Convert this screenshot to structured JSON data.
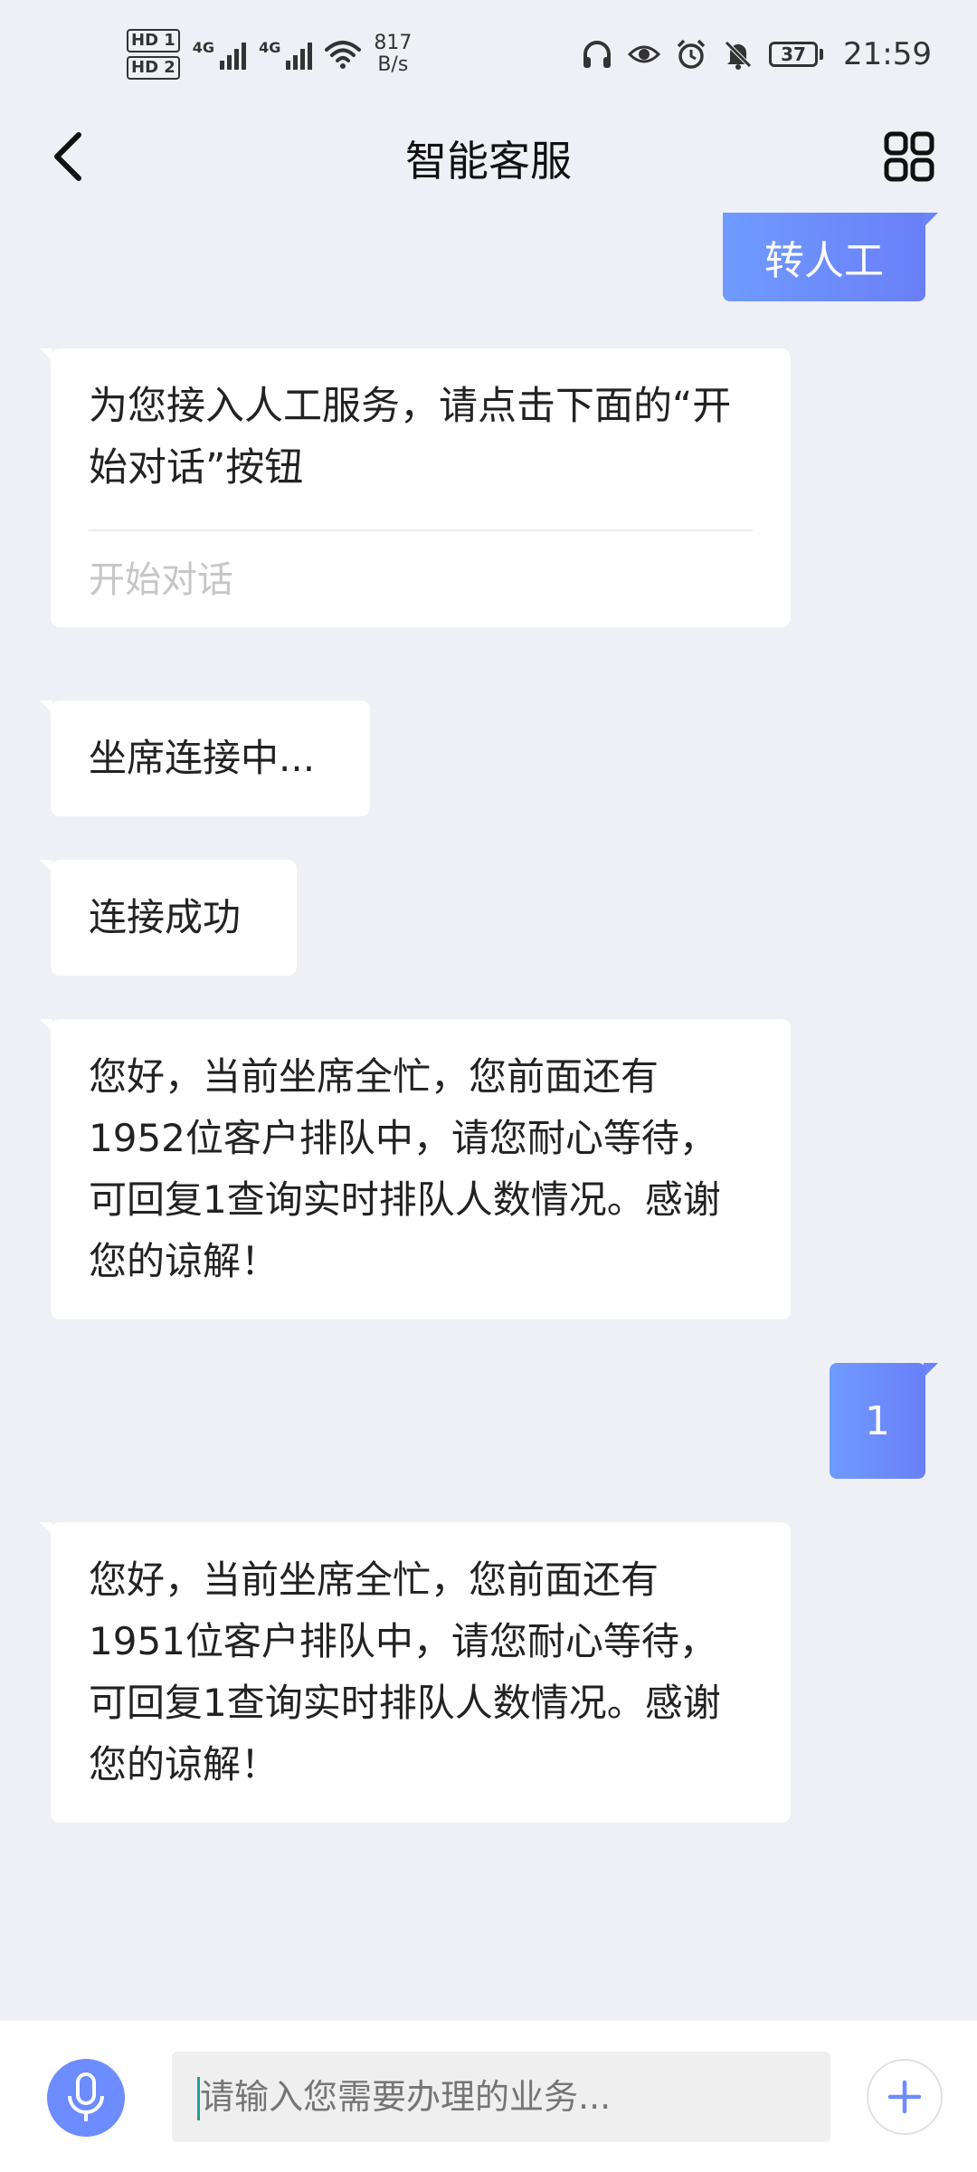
{
  "status_bar": {
    "hd1": "HD 1",
    "hd2": "HD 2",
    "sig1": "4G",
    "sig2": "4G",
    "net_speed_value": "817",
    "net_speed_unit": "B/s",
    "battery": "37",
    "time": "21:59"
  },
  "header": {
    "title": "智能客服"
  },
  "messages": {
    "m0": {
      "text": "转人工"
    },
    "m1": {
      "text": "为您接入人工服务，请点击下面的“开始对话”按钮",
      "link": "开始对话"
    },
    "m2": {
      "text": "坐席连接中..."
    },
    "m3": {
      "text": "连接成功"
    },
    "m4": {
      "text": "您好，当前坐席全忙，您前面还有1952位客户排队中，请您耐心等待，可回复1查询实时排队人数情况。感谢您的谅解！"
    },
    "m5": {
      "text": "1"
    },
    "m6": {
      "text": "您好，当前坐席全忙，您前面还有1951位客户排队中，请您耐心等待，可回复1查询实时排队人数情况。感谢您的谅解！"
    }
  },
  "input": {
    "placeholder": "请输入您需要办理的业务..."
  },
  "colors": {
    "accent": "#6c8cff",
    "background": "#eef0f5"
  }
}
